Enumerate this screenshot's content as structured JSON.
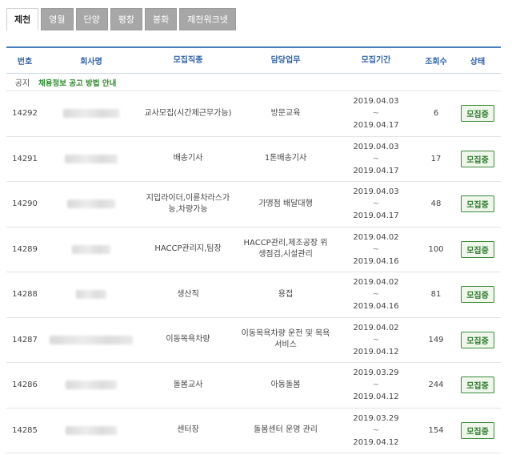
{
  "tabs": [
    {
      "label": "제천",
      "active": true
    },
    {
      "label": "영월",
      "active": false
    },
    {
      "label": "단양",
      "active": false
    },
    {
      "label": "평창",
      "active": false
    },
    {
      "label": "봉화",
      "active": false
    },
    {
      "label": "제천워크넷",
      "active": false
    }
  ],
  "headers": {
    "num": "번호",
    "company": "회사명",
    "job": "모집직종",
    "work": "담당업무",
    "period": "모집기간",
    "views": "조회수",
    "status": "상태"
  },
  "notice": {
    "label": "공지",
    "text": "채용정보 공고 방법 안내"
  },
  "rows": [
    {
      "num": "14292",
      "blur_width": 70,
      "job": "교사모집(시간제근무가능)",
      "work": "방문교육",
      "start": "2019.04.03",
      "sep": "~",
      "end": "2019.04.17",
      "views": "6",
      "status": "모집중"
    },
    {
      "num": "14291",
      "blur_width": 66,
      "job": "배송기사",
      "work": "1톤배송기사",
      "start": "2019.04.03",
      "sep": "~",
      "end": "2019.04.17",
      "views": "17",
      "status": "모집중"
    },
    {
      "num": "14290",
      "blur_width": 60,
      "job": "지입라이더,이륜차라스가능,차량가능",
      "work": "가맹점 배달대행",
      "start": "2019.04.03",
      "sep": "~",
      "end": "2019.04.17",
      "views": "48",
      "status": "모집중"
    },
    {
      "num": "14289",
      "blur_width": 48,
      "job": "HACCP관리지,팀장",
      "work": "HACCP관리,제조공장 위생점검,시설관리",
      "start": "2019.04.02",
      "sep": "~",
      "end": "2019.04.16",
      "views": "100",
      "status": "모집중"
    },
    {
      "num": "14288",
      "blur_width": 38,
      "job": "생산직",
      "work": "용접",
      "start": "2019.04.02",
      "sep": "~",
      "end": "2019.04.16",
      "views": "81",
      "status": "모집중"
    },
    {
      "num": "14287",
      "blur_width": 104,
      "job": "이동목욕차량",
      "work": "이동목욕차량 운전 및 목욕서비스",
      "start": "2019.04.02",
      "sep": "~",
      "end": "2019.04.12",
      "views": "149",
      "status": "모집중"
    },
    {
      "num": "14286",
      "blur_width": 64,
      "job": "돌봄교사",
      "work": "아동돌봄",
      "start": "2019.03.29",
      "sep": "~",
      "end": "2019.04.12",
      "views": "244",
      "status": "모집중"
    },
    {
      "num": "14285",
      "blur_width": 64,
      "job": "센터장",
      "work": "돌봄센터 운영 관리",
      "start": "2019.03.29",
      "sep": "~",
      "end": "2019.04.12",
      "views": "154",
      "status": "모집중"
    }
  ]
}
